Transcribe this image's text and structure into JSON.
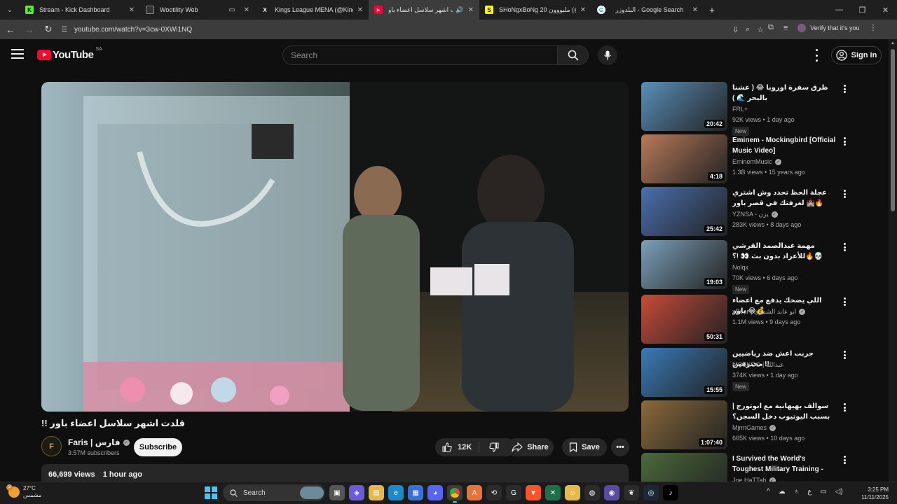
{
  "browser": {
    "tabs": [
      {
        "title": "Stream - Kick Dashboard",
        "favicon_color": "#53fc18",
        "favicon_glyph": "K"
      },
      {
        "title": "Wootility Web",
        "favicon_color": "#1f1f1f",
        "favicon_glyph": ""
      },
      {
        "title": "Kings League MENA (@KingsLe",
        "favicon_color": "#1f1f1f",
        "favicon_glyph": "X"
      },
      {
        "title": "قلدت اشهر سلاسل اعضاء باو",
        "favicon_color": "#ff0033",
        "favicon_glyph": "▶",
        "active": true
      },
      {
        "title": "SHoNgxBoNg 20 مليووون (@sh",
        "favicon_color": "#fffc00",
        "favicon_glyph": "S"
      },
      {
        "title": "البلدوزر - Google Search",
        "favicon_color": "#ffffff",
        "favicon_glyph": "G"
      }
    ],
    "url": "youtube.com/watch?v=3cw-0XWi1NQ",
    "profile_label": "Verify that it's you"
  },
  "header": {
    "logo_text": "YouTube",
    "country_code": "SA",
    "search_placeholder": "Search",
    "signin_label": "Sign in"
  },
  "video": {
    "title": "قلدت اشهر سلاسل اعضاء باور !!",
    "channel_name": "Faris | فارس",
    "subscribers": "3.57M subscribers",
    "subscribe_label": "Subscribe",
    "likes": "12K",
    "share_label": "Share",
    "save_label": "Save",
    "views": "66,699 views",
    "posted": "1 hour ago"
  },
  "recommendations": [
    {
      "title": "ظرق سفرة اوروبا 😂 ( عشنا بالبحر 🌊 )",
      "channel": "FRL+",
      "verified": false,
      "views": "92K views",
      "age": "1 day ago",
      "badge": "New",
      "duration": "20:42",
      "thumb_color": "#5a8fb8"
    },
    {
      "title": "Eminem - Mockingbird [Official Music Video]",
      "channel": "EminemMusic",
      "verified": true,
      "views": "1.3B views",
      "age": "15 years ago",
      "badge": "",
      "duration": "4:18",
      "thumb_color": "#b87a5a"
    },
    {
      "title": "عجلة الحظ تحدد وش اشتري لغرفتك في قصر باور 🏰🔥",
      "channel": "YZNSA - يزن",
      "verified": true,
      "views": "283K views",
      "age": "8 days ago",
      "badge": "",
      "duration": "25:42",
      "thumb_color": "#4a6fb0"
    },
    {
      "title": "مهمة عبدالصمد القرشي للأعراد بدون بث 👀 !؟🔥💀",
      "channel": "Nolqx",
      "verified": false,
      "views": "70K views",
      "age": "6 days ago",
      "badge": "New",
      "duration": "19:03",
      "thumb_color": "#7aa0b8"
    },
    {
      "title": "اللي يضحك يدفع مع اعضاء باور 😂💰",
      "channel": "xBear | ابو عابد الشمري",
      "verified": true,
      "views": "1.1M views",
      "age": "9 days ago",
      "badge": "",
      "duration": "50:31",
      "thumb_color": "#c84a3a"
    },
    {
      "title": "جربت اعش ضد رياضيين محترفين !!",
      "channel": "MOSKOO | عبدالله",
      "verified": false,
      "views": "374K views",
      "age": "1 day ago",
      "badge": "New",
      "duration": "15:55",
      "thumb_color": "#3a7ab8"
    },
    {
      "title": "سوالف بهيهانية مع ابوتورج | بسبب اليوتيوب دخل السجن؟ 😂🔥 !",
      "channel": "MjrmGames",
      "verified": true,
      "views": "665K views",
      "age": "10 days ago",
      "badge": "",
      "duration": "1:07:40",
      "thumb_color": "#8a6a3a"
    },
    {
      "title": "I Survived the World's Toughest Military Training - Colombia 🇨🇴",
      "channel": "Joe HaTTab",
      "verified": true,
      "views": "",
      "age": "",
      "badge": "",
      "duration": "",
      "thumb_color": "#4a6a3a"
    }
  ],
  "taskbar": {
    "temperature": "27°C",
    "weather_desc": "مشمس",
    "weather_badge": "3",
    "search_label": "Search",
    "lang": "ع",
    "time": "3:25 PM",
    "date": "11/11/2025"
  }
}
